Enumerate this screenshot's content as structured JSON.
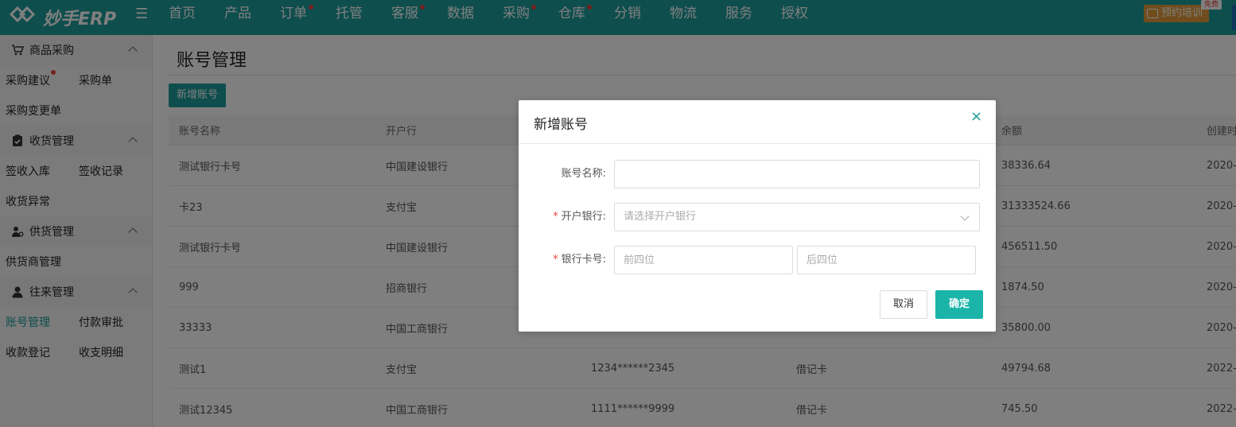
{
  "colors": {
    "brand": "#1d9c9b",
    "accent_orange": "#e29a3a",
    "dot_red": "#e8453c",
    "confirm": "#1ab5a8"
  },
  "app": {
    "logo_text": "妙手ERP",
    "logo_icon": "diamond-logo-icon",
    "menu_icon": "menu-icon"
  },
  "nav": [
    {
      "label": "首页",
      "dot": false
    },
    {
      "label": "产品",
      "dot": false
    },
    {
      "label": "订单",
      "dot": true
    },
    {
      "label": "托管",
      "dot": false
    },
    {
      "label": "客服",
      "dot": true
    },
    {
      "label": "数据",
      "dot": false
    },
    {
      "label": "采购",
      "dot": true
    },
    {
      "label": "仓库",
      "dot": true
    },
    {
      "label": "分销",
      "dot": false
    },
    {
      "label": "物流",
      "dot": false
    },
    {
      "label": "服务",
      "dot": false
    },
    {
      "label": "授权",
      "dot": false
    }
  ],
  "header_right": {
    "train_label": "预约培训",
    "free_badge": "免费"
  },
  "sidebar": {
    "groups": [
      {
        "title": "商品采购",
        "icon": "cart-icon",
        "rows": [
          [
            {
              "label": "采购建议",
              "dot": true
            },
            {
              "label": "采购单"
            }
          ],
          [
            {
              "label": "采购变更单"
            }
          ]
        ]
      },
      {
        "title": "收货管理",
        "icon": "clipboard-icon",
        "rows": [
          [
            {
              "label": "签收入库"
            },
            {
              "label": "签收记录"
            }
          ],
          [
            {
              "label": "收货异常"
            }
          ]
        ]
      },
      {
        "title": "供货管理",
        "icon": "supplier-icon",
        "rows": [
          [
            {
              "label": "供货商管理"
            }
          ]
        ]
      },
      {
        "title": "往来管理",
        "icon": "person-icon",
        "rows": [
          [
            {
              "label": "账号管理",
              "active": true
            },
            {
              "label": "付款审批"
            }
          ],
          [
            {
              "label": "收款登记"
            },
            {
              "label": "收支明细"
            }
          ]
        ]
      }
    ]
  },
  "main": {
    "title": "账号管理",
    "add_button": "新增账号",
    "table": {
      "headers": [
        "账号名称",
        "开户行",
        "",
        "",
        "余额",
        "创建时"
      ],
      "rows": [
        [
          "测试银行卡号",
          "中国建设银行",
          "",
          "",
          "38336.64",
          "2020-"
        ],
        [
          "卡23",
          "支付宝",
          "",
          "",
          "31333524.66",
          "2020-"
        ],
        [
          "测试银行卡号",
          "中国建设银行",
          "",
          "",
          "456511.50",
          "2020-"
        ],
        [
          "999",
          "招商银行",
          "",
          "",
          "1874.50",
          "2020-"
        ],
        [
          "33333",
          "中国工商银行",
          "",
          "",
          "35800.00",
          "2020-"
        ],
        [
          "测试1",
          "支付宝",
          "1234******2345",
          "借记卡",
          "49794.68",
          "2022-"
        ],
        [
          "测试12345",
          "中国工商银行",
          "1111******9999",
          "借记卡",
          "745.50",
          "2022-"
        ]
      ]
    }
  },
  "modal": {
    "title": "新增账号",
    "fields": {
      "name_label": "账号名称:",
      "name_value": "",
      "bank_label": "开户银行:",
      "bank_placeholder": "请选择开户银行",
      "card_label": "银行卡号:",
      "card_first_placeholder": "前四位",
      "card_last_placeholder": "后四位",
      "required_mark": "*"
    },
    "cancel": "取消",
    "confirm": "确定"
  }
}
